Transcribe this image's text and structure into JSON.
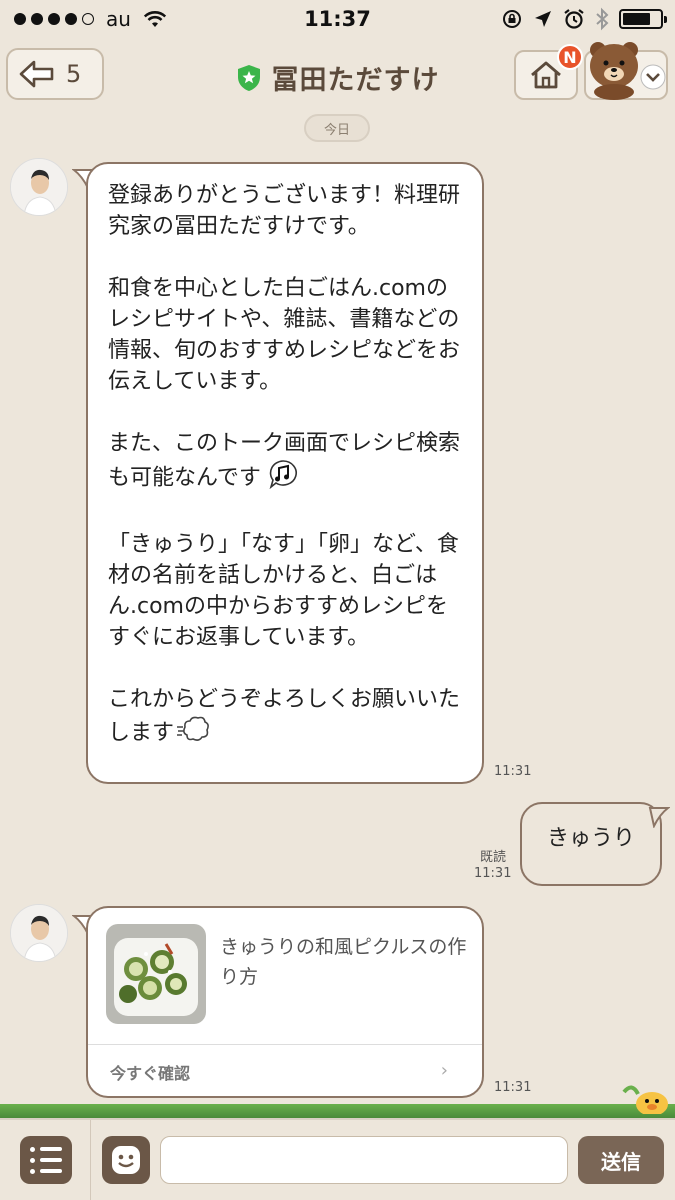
{
  "status_bar": {
    "carrier": "au",
    "time": "11:37",
    "battery_level": 0.75
  },
  "header": {
    "back_count": "5",
    "title": "冨田ただすけ",
    "notification_badge": "N"
  },
  "chat": {
    "date_label": "今日",
    "messages": [
      {
        "text": "登録ありがとうございます！料理研究家の冨田ただすけです。\n\n和食を中心とした白ごはん.comのレシピサイトや、雑誌、書籍などの情報、旬のおすすめレシピなどをお伝えしています。\n\nまた、このトーク画面でレシピ検索も可能なんです",
        "text_part2": "「きゅうり」「なす」「卵」など、食材の名前を話しかけると、白ごはん.comの中からおすすめレシピをすぐにお返事しています。\n\nこれからどうぞよろしくお願いいたします",
        "time": "11:31"
      },
      {
        "text": "きゅうり",
        "read_status": "既読",
        "time": "11:31"
      },
      {
        "card_title": "きゅうりの和風ピクルスの作り方",
        "card_action": "今すぐ確認",
        "time": "11:31"
      }
    ]
  },
  "input_bar": {
    "placeholder": "",
    "send_label": "送信"
  },
  "colors": {
    "background": "#ede6db",
    "bubble_border": "#8c7565",
    "accent_brown": "#6b5747",
    "verified_green": "#3bb54a",
    "badge_red": "#e8532a"
  },
  "icons": {
    "back": "back-arrow-icon",
    "verified": "verified-shield-icon",
    "home": "home-icon",
    "menu": "chevron-down-icon",
    "music": "music-note-icon",
    "puff": "puff-icon",
    "list": "list-icon",
    "emoji": "emoji-face-icon"
  }
}
